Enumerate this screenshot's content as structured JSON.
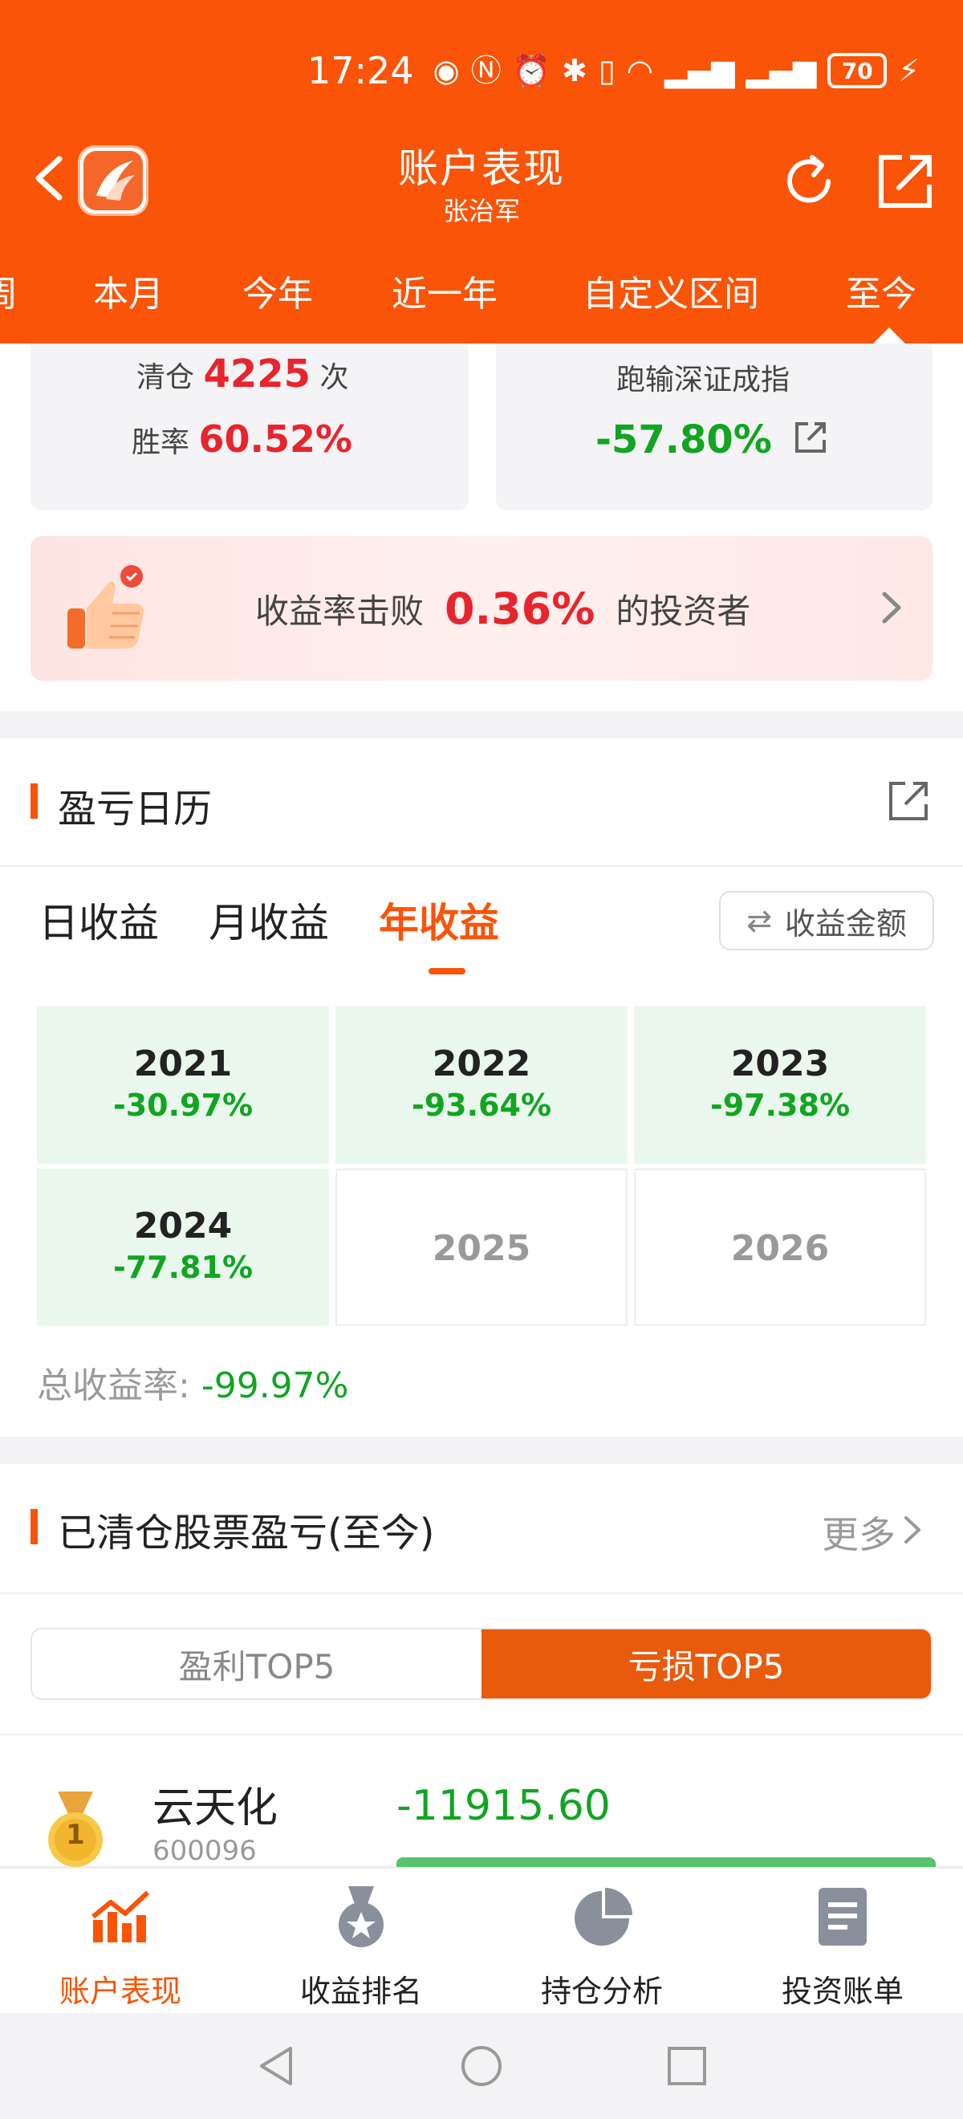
{
  "status_bar": {
    "time": "17:24",
    "battery": "70"
  },
  "header": {
    "title": "账户表现",
    "subtitle": "张治军",
    "period_tabs": [
      "周",
      "本月",
      "今年",
      "近一年",
      "自定义区间",
      "至今"
    ],
    "active_period": "至今"
  },
  "stats": {
    "clear_label": "清仓",
    "clear_count": "4225",
    "clear_unit": "次",
    "win_label": "胜率",
    "win_rate": "60.52%",
    "index_label": "跑输深证成指",
    "index_value": "-57.80%"
  },
  "beat_banner": {
    "prefix": "收益率击败",
    "percent": "0.36%",
    "suffix": "的投资者"
  },
  "calendar": {
    "title": "盈亏日历",
    "tabs": [
      "日收益",
      "月收益",
      "年收益"
    ],
    "active_tab": "年收益",
    "toggle_label": "收益金额",
    "years": [
      {
        "year": "2021",
        "value": "-30.97%"
      },
      {
        "year": "2022",
        "value": "-93.64%"
      },
      {
        "year": "2023",
        "value": "-97.38%"
      },
      {
        "year": "2024",
        "value": "-77.81%"
      },
      {
        "year": "2025",
        "value": ""
      },
      {
        "year": "2026",
        "value": ""
      }
    ],
    "total_label": "总收益率:",
    "total_value": "-99.97%"
  },
  "cleared": {
    "title": "已清仓股票盈亏(至今)",
    "more": "更多",
    "segments": [
      "盈利TOP5",
      "亏损TOP5"
    ],
    "active_segment": "亏损TOP5",
    "items": [
      {
        "rank": "1",
        "name": "云天化",
        "code": "600096",
        "pnl": "-11915.60"
      }
    ]
  },
  "bottom_nav": {
    "items": [
      "账户表现",
      "收益排名",
      "持仓分析",
      "投资账单"
    ],
    "active": "账户表现"
  },
  "colors": {
    "brand": "#f95408",
    "loss": "#11a522",
    "gain": "#e8242d"
  }
}
